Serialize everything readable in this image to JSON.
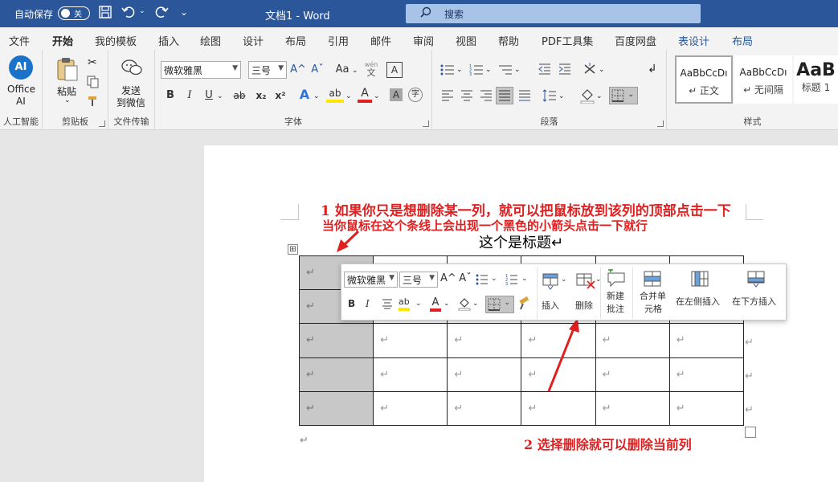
{
  "titlebar": {
    "autosave_label": "自动保存",
    "toggle_state": "关",
    "doc_title": "文档1  -  Word",
    "search_placeholder": "搜索"
  },
  "tabs": [
    "文件",
    "开始",
    "我的模板",
    "插入",
    "绘图",
    "设计",
    "布局",
    "引用",
    "邮件",
    "审阅",
    "视图",
    "帮助",
    "PDF工具集",
    "百度网盘",
    "表设计",
    "布局"
  ],
  "ribbon": {
    "ai": {
      "line1": "Office",
      "line2": "AI",
      "group": "人工智能"
    },
    "clipboard": {
      "paste": "粘贴",
      "group": "剪贴板"
    },
    "transfer": {
      "line1": "发送",
      "line2": "到微信",
      "group": "文件传输"
    },
    "font": {
      "name": "微软雅黑",
      "size": "三号",
      "group": "字体",
      "bold": "B",
      "italic": "I",
      "underline": "U",
      "strike": "ab",
      "sub": "x₂",
      "sup": "x²",
      "grow": "A^",
      "shrink": "Aˇ",
      "case": "Aa",
      "pinyin": "wén",
      "pinyin_base": "文",
      "border_char": "A",
      "text_effect": "A",
      "highlight": "ab",
      "font_color": "A",
      "shade_char": "A",
      "circle_char": "字"
    },
    "paragraph": {
      "group": "段落"
    },
    "styles": {
      "group": "样式",
      "items": [
        {
          "preview": "AaBbCcDı",
          "name": "↵ 正文"
        },
        {
          "preview": "AaBbCcDı",
          "name": "↵ 无间隔"
        },
        {
          "preview": "AaB",
          "name": "标题 1"
        }
      ]
    }
  },
  "document": {
    "annotation1_line1": "1  如果你只是想删除某一列，就可以把鼠标放到该列的顶部点击一下",
    "annotation1_line2": "当你鼠标在这个条线上会出现一个黑色的小箭头点击一下就行",
    "heading": "这个是标题↵",
    "annotation2": "2  选择删除就可以删除当前列",
    "para_mark": "↵",
    "cell_mark": "↵",
    "table_move_handle": "⊞"
  },
  "minitoolbar": {
    "font": "微软雅黑",
    "size": "三号",
    "insert_label": "插入",
    "delete_label": "删除",
    "new_comment_line1": "新建",
    "new_comment_line2": "批注",
    "merge_line1": "合并单",
    "merge_line2": "元格",
    "insert_left": "在左侧插入",
    "insert_below": "在下方插入",
    "bold": "B",
    "italic": "I",
    "font_color": "A",
    "highlight": "ab",
    "grow": "A^",
    "shrink": "Aˇ"
  },
  "colors": {
    "titlebar": "#2b579a",
    "annotation": "#e02020",
    "selected_column": "#c8c8c8",
    "highlight_yellow": "#ffe600",
    "font_red": "#e02020"
  }
}
